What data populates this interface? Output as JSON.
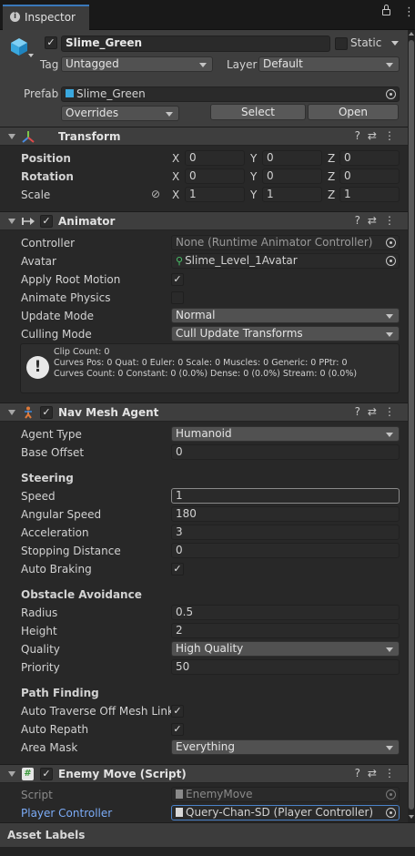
{
  "tab": {
    "title": "Inspector"
  },
  "object": {
    "name": "Slime_Green",
    "static_label": "Static",
    "tag_label": "Tag",
    "tag_value": "Untagged",
    "layer_label": "Layer",
    "layer_value": "Default"
  },
  "prefab": {
    "label": "Prefab",
    "value": "Slime_Green",
    "overrides": "Overrides",
    "select": "Select",
    "open": "Open"
  },
  "transform": {
    "title": "Transform",
    "position": {
      "label": "Position",
      "x": "0",
      "y": "0",
      "z": "0"
    },
    "rotation": {
      "label": "Rotation",
      "x": "0",
      "y": "0",
      "z": "0"
    },
    "scale": {
      "label": "Scale",
      "x": "1",
      "y": "1",
      "z": "1"
    },
    "axis": {
      "x": "X",
      "y": "Y",
      "z": "Z"
    }
  },
  "animator": {
    "title": "Animator",
    "controller_label": "Controller",
    "controller_value": "None (Runtime Animator Controller)",
    "avatar_label": "Avatar",
    "avatar_value": "Slime_Level_1Avatar",
    "apply_root_motion_label": "Apply Root Motion",
    "animate_physics_label": "Animate Physics",
    "update_mode_label": "Update Mode",
    "update_mode_value": "Normal",
    "culling_mode_label": "Culling Mode",
    "culling_mode_value": "Cull Update Transforms",
    "info": {
      "line1": "Clip Count: 0",
      "line2": "Curves Pos: 0 Quat: 0 Euler: 0 Scale: 0 Muscles: 0 Generic: 0 PPtr: 0",
      "line3": "Curves Count: 0 Constant: 0 (0.0%) Dense: 0 (0.0%) Stream: 0 (0.0%)"
    }
  },
  "navmesh": {
    "title": "Nav Mesh Agent",
    "agent_type_label": "Agent Type",
    "agent_type_value": "Humanoid",
    "base_offset_label": "Base Offset",
    "base_offset_value": "0",
    "steering_header": "Steering",
    "speed_label": "Speed",
    "speed_value": "1",
    "angular_speed_label": "Angular Speed",
    "angular_speed_value": "180",
    "acceleration_label": "Acceleration",
    "acceleration_value": "3",
    "stopping_distance_label": "Stopping Distance",
    "stopping_distance_value": "0",
    "auto_braking_label": "Auto Braking",
    "obstacle_header": "Obstacle Avoidance",
    "radius_label": "Radius",
    "radius_value": "0.5",
    "height_label": "Height",
    "height_value": "2",
    "quality_label": "Quality",
    "quality_value": "High Quality",
    "priority_label": "Priority",
    "priority_value": "50",
    "pathfinding_header": "Path Finding",
    "auto_traverse_label": "Auto Traverse Off Mesh Link",
    "auto_repath_label": "Auto Repath",
    "area_mask_label": "Area Mask",
    "area_mask_value": "Everything"
  },
  "enemy_move": {
    "title": "Enemy Move (Script)",
    "script_label": "Script",
    "script_value": "EnemyMove",
    "player_controller_label": "Player Controller",
    "player_controller_value": "Query-Chan-SD (Player Controller)"
  },
  "footer": {
    "asset_labels": "Asset Labels"
  },
  "colors": {
    "background": "#282828",
    "header": "#3e3e3e",
    "accent_blue": "#7cacf7",
    "field": "#2a2a2a"
  }
}
